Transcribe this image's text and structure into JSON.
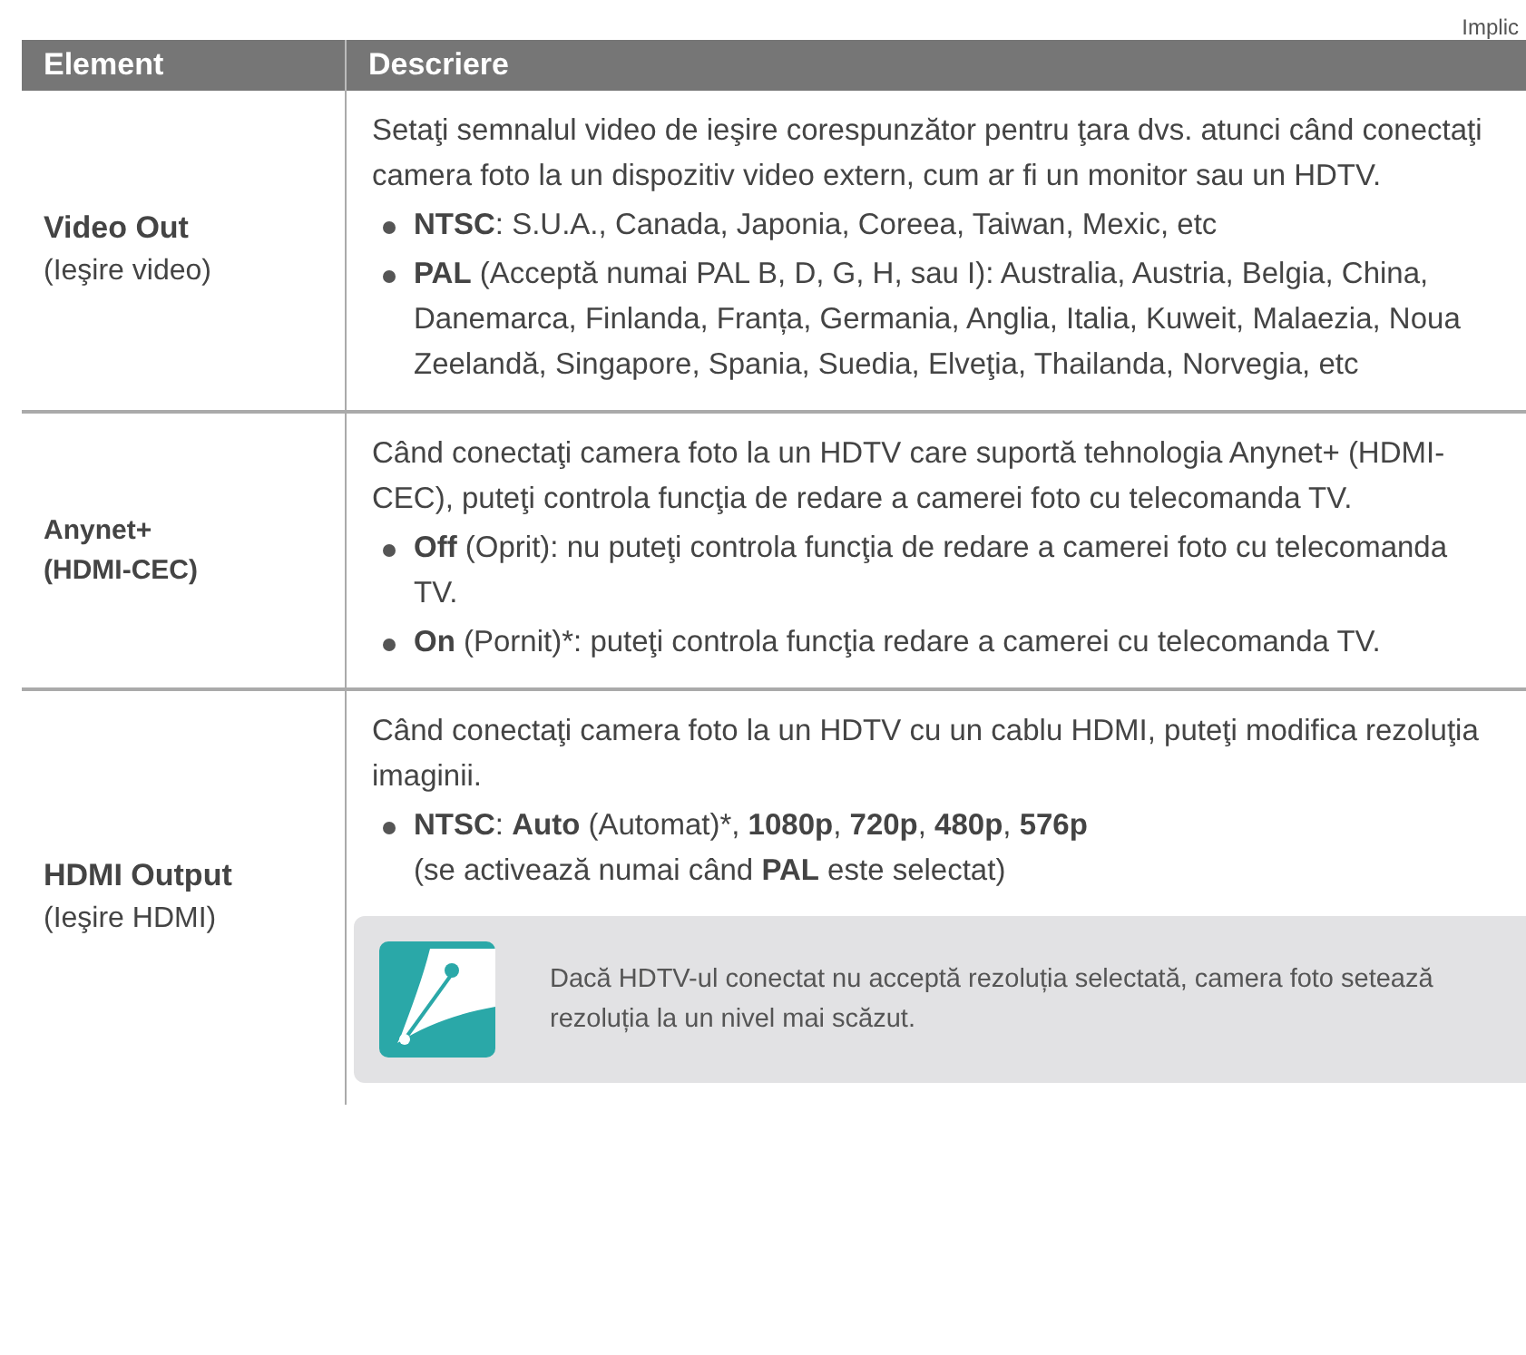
{
  "corner_text": "Implic",
  "table": {
    "columns": [
      "Element",
      "Descriere"
    ],
    "rows": [
      {
        "element": {
          "title": "Video Out",
          "subtitle": "(Ieşire video)",
          "subtitle_bold": false
        },
        "paragraph": "Setaţi semnalul video de ieşire corespunzător pentru ţara dvs. atunci când conectaţi camera foto la un dispozitiv video extern, cum ar fi un monitor sau un HDTV.",
        "bullets": [
          "**NTSC**: S.U.A., Canada, Japonia, Coreea, Taiwan, Mexic, etc",
          "**PAL** (Acceptă numai PAL B, D, G, H, sau I): Australia, Austria, Belgia, China, Danemarca, Finlanda, Franța, Germania, Anglia, Italia, Kuweit, Malaezia, Noua Zeelandă, Singapore, Spania, Suedia, Elveţia, Thailanda, Norvegia, etc"
        ]
      },
      {
        "element": {
          "title": "Anynet+",
          "subtitle": "(HDMI-CEC)",
          "subtitle_bold": true
        },
        "paragraph": "Când conectaţi camera foto la un HDTV care suportă tehnologia Anynet+ (HDMI-CEC), puteţi controla funcţia de redare a camerei foto cu telecomanda TV.",
        "bullets": [
          "**Off** (Oprit): nu puteţi controla funcţia de redare a camerei foto cu telecomanda TV.",
          "**On** (Pornit)*: puteţi controla funcţia redare a camerei cu telecomanda TV."
        ]
      },
      {
        "element": {
          "title": "HDMI Output",
          "subtitle": "(Ieşire HDMI)",
          "subtitle_bold": false
        },
        "paragraph": "Când conectaţi camera foto la un HDTV cu un cablu HDMI, puteţi modifica rezoluţia imaginii.",
        "bullets": [
          "**NTSC**: **Auto** (Automat)*, **1080p**, **720p**, **480p**, **576p**\n(se activează numai când **PAL** este selectat)"
        ],
        "note": "Dacă HDTV-ul conectat nu acceptă rezoluția selectată, camera foto setează rezoluția la un nivel mai scăzut."
      }
    ]
  }
}
